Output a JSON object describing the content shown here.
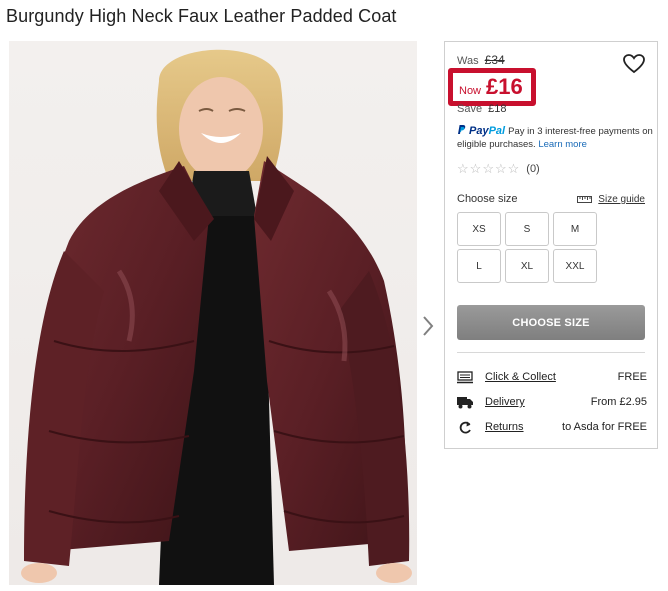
{
  "product": {
    "title": "Burgundy High Neck Faux Leather Padded Coat"
  },
  "pricing": {
    "was_label": "Was",
    "was_price": "£34",
    "now_label": "Now",
    "now_price": "£16",
    "save_label": "Save",
    "save_amount": "£18"
  },
  "paypal": {
    "brand_pay": "Pay",
    "brand_pal": "Pal",
    "text": "Pay in 3 interest-free payments on eligible purchases.",
    "learn_more": "Learn more"
  },
  "rating": {
    "stars": 0,
    "max": 5,
    "count": "(0)"
  },
  "sizes": {
    "label": "Choose size",
    "guide": "Size guide",
    "options": [
      "XS",
      "S",
      "M",
      "L",
      "XL",
      "XXL"
    ]
  },
  "cta": {
    "label": "CHOOSE SIZE"
  },
  "services": [
    {
      "label": "Click & Collect",
      "value": "FREE",
      "icon": "click-collect-icon"
    },
    {
      "label": "Delivery",
      "value": "From £2.95",
      "icon": "truck-icon"
    },
    {
      "label": "Returns",
      "value": "to Asda for FREE",
      "icon": "returns-icon"
    }
  ],
  "colors": {
    "accent_red": "#c8102e",
    "paypal_dark": "#003087",
    "paypal_light": "#009cde",
    "button_grey": "#8c8c8c"
  }
}
